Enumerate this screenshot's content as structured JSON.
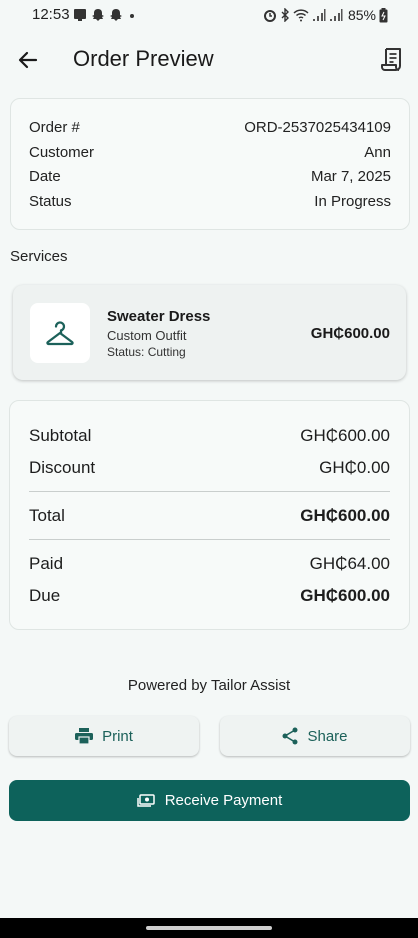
{
  "status_bar": {
    "time": "12:53",
    "battery": "85%"
  },
  "header": {
    "title": "Order Preview"
  },
  "order": {
    "fields": [
      {
        "label": "Order #",
        "value": "ORD-2537025434109"
      },
      {
        "label": "Customer",
        "value": "Ann"
      },
      {
        "label": "Date",
        "value": "Mar 7, 2025"
      },
      {
        "label": "Status",
        "value": "In Progress"
      }
    ]
  },
  "services": {
    "section_label": "Services",
    "items": [
      {
        "name": "Sweater Dress",
        "category": "Custom Outfit",
        "status": "Status: Cutting",
        "price": "GH₵600.00"
      }
    ]
  },
  "totals": {
    "subtotal": {
      "label": "Subtotal",
      "value": "GH₵600.00"
    },
    "discount": {
      "label": "Discount",
      "value": "GH₵0.00"
    },
    "total": {
      "label": "Total",
      "value": "GH₵600.00"
    },
    "paid": {
      "label": "Paid",
      "value": "GH₵64.00"
    },
    "due": {
      "label": "Due",
      "value": "GH₵600.00"
    }
  },
  "footer": {
    "powered_by": "Powered by Tailor Assist"
  },
  "actions": {
    "print_label": "Print",
    "share_label": "Share",
    "receive_payment_label": "Receive Payment"
  },
  "colors": {
    "primary": "#0d625b",
    "background": "#f4f8f7",
    "icon_accent": "#1c615a"
  }
}
